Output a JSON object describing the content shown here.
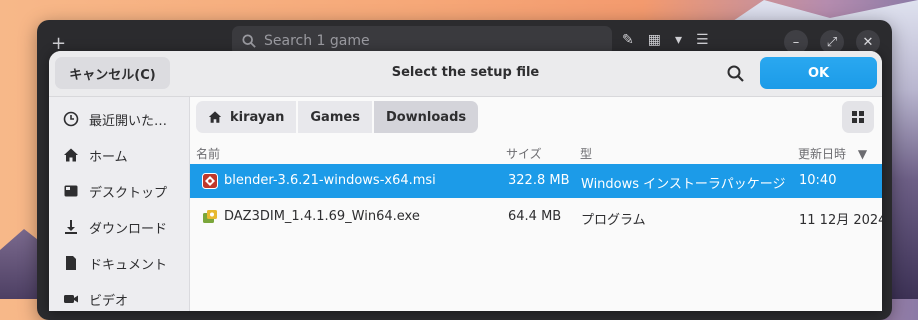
{
  "back_window": {
    "search_placeholder": "Search 1 game"
  },
  "dialog": {
    "cancel_label": "キャンセル(C)",
    "title": "Select the setup file",
    "ok_label": "OK"
  },
  "sidebar": {
    "items": [
      {
        "label": "最近開いた…",
        "icon": "clock-icon"
      },
      {
        "label": "ホーム",
        "icon": "home-icon"
      },
      {
        "label": "デスクトップ",
        "icon": "desktop-icon"
      },
      {
        "label": "ダウンロード",
        "icon": "download-icon"
      },
      {
        "label": "ドキュメント",
        "icon": "document-icon"
      },
      {
        "label": "ビデオ",
        "icon": "video-icon"
      }
    ]
  },
  "pathbar": {
    "crumbs": [
      "kirayan",
      "Games",
      "Downloads"
    ]
  },
  "columns": {
    "name": "名前",
    "size": "サイズ",
    "type": "型",
    "modified": "更新日時"
  },
  "files": [
    {
      "name": "blender-3.6.21-windows-x64.msi",
      "size": "322.8 MB",
      "type": "Windows インストーラパッケージ",
      "modified": "10:40",
      "selected": true
    },
    {
      "name": "DAZ3DIM_1.4.1.69_Win64.exe",
      "size": "64.4 MB",
      "type": "プログラム",
      "modified": "11 12月 2024",
      "selected": false
    }
  ],
  "colors": {
    "accent": "#1c9be8",
    "header_bg": "#ebebed",
    "sidebar_bg": "#ededf0"
  }
}
